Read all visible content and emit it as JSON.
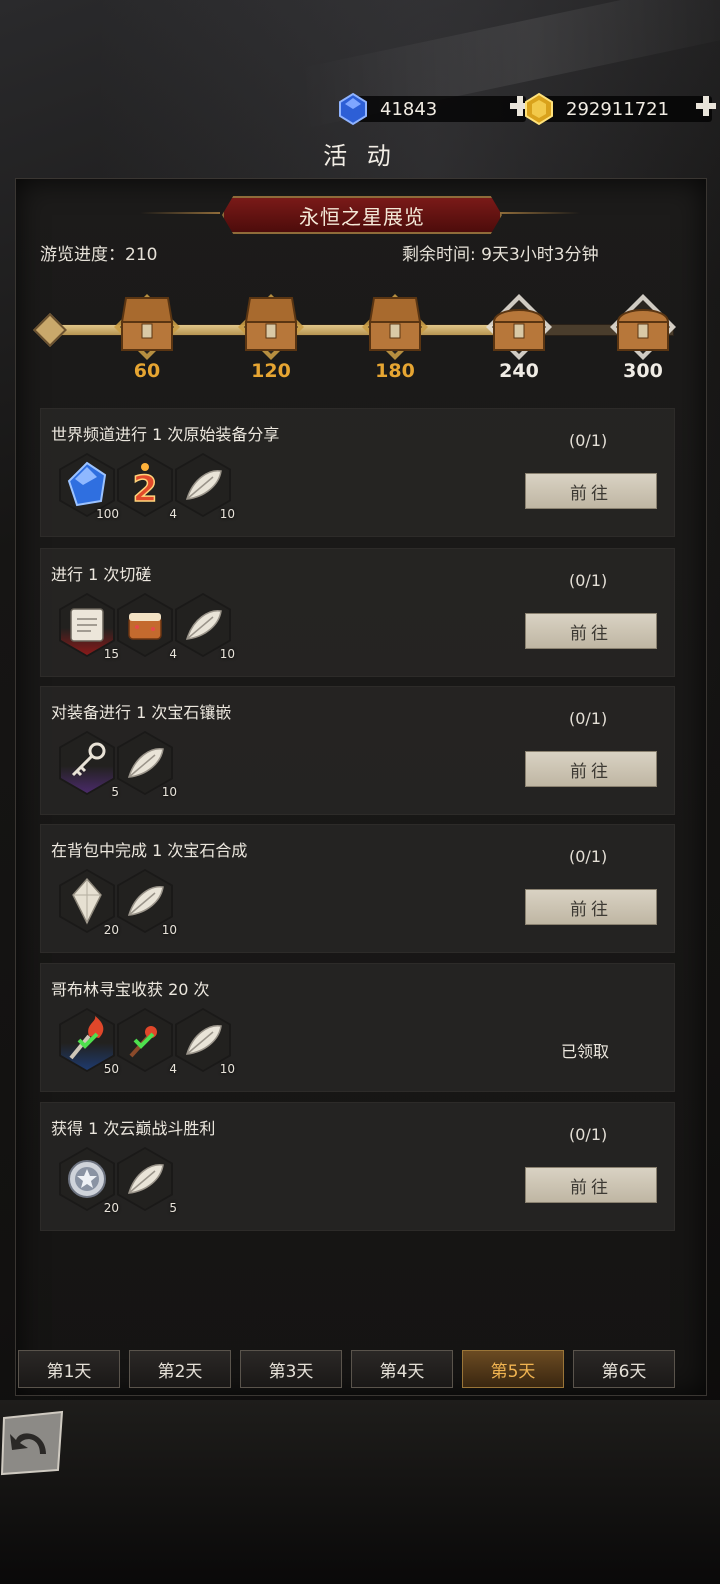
{
  "currency": {
    "gems": "41843",
    "gold": "292911721",
    "gems_icon": "blue-gem-icon",
    "gold_icon": "gold-coin-icon"
  },
  "page_title": "活 动",
  "event": {
    "name": "永恒之星展览",
    "progress_label": "游览进度：",
    "progress_value": "210",
    "time_label": "剩余时间:",
    "time_value": "9天3小时3分钟",
    "progress_fraction": 0.72
  },
  "milestones": [
    {
      "label": "60",
      "opened": true
    },
    {
      "label": "120",
      "opened": true
    },
    {
      "label": "180",
      "opened": true
    },
    {
      "label": "240",
      "opened": false
    },
    {
      "label": "300",
      "opened": false
    }
  ],
  "tasks": [
    {
      "title": "世界频道进行 1 次原始装备分享",
      "count": "(0/1)",
      "status": "go",
      "rewards": [
        {
          "icon": "blue-crystal-icon",
          "qty": "100"
        },
        {
          "icon": "number-two-icon",
          "qty": "4"
        },
        {
          "icon": "feather-icon",
          "qty": "10"
        }
      ]
    },
    {
      "title": "进行 1 次切磋",
      "count": "(0/1)",
      "status": "go",
      "rewards": [
        {
          "icon": "scroll-icon",
          "qty": "15"
        },
        {
          "icon": "cake-icon",
          "qty": "4"
        },
        {
          "icon": "feather-icon",
          "qty": "10"
        }
      ]
    },
    {
      "title": "对装备进行 1 次宝石镶嵌",
      "count": "(0/1)",
      "status": "go",
      "rewards": [
        {
          "icon": "key-icon",
          "qty": "5"
        },
        {
          "icon": "feather-icon",
          "qty": "10"
        }
      ]
    },
    {
      "title": "在背包中完成 1 次宝石合成",
      "count": "(0/1)",
      "status": "go",
      "rewards": [
        {
          "icon": "white-crystal-icon",
          "qty": "20"
        },
        {
          "icon": "feather-icon",
          "qty": "10"
        }
      ]
    },
    {
      "title": "哥布林寻宝收获 20 次",
      "count": "",
      "status": "claimed",
      "rewards": [
        {
          "icon": "torch-icon",
          "qty": "50"
        },
        {
          "icon": "firework-icon",
          "qty": "4"
        },
        {
          "icon": "feather-icon",
          "qty": "10"
        }
      ]
    },
    {
      "title": "获得 1 次云巅战斗胜利",
      "count": "(0/1)",
      "status": "go",
      "rewards": [
        {
          "icon": "star-medal-icon",
          "qty": "20"
        },
        {
          "icon": "feather-icon",
          "qty": "5"
        }
      ]
    }
  ],
  "go_label": "前往",
  "claimed_label": "已领取",
  "day_tabs": [
    "第1天",
    "第2天",
    "第3天",
    "第4天",
    "第5天",
    "第6天"
  ],
  "active_day_index": 4,
  "colors": {
    "banner_red": "#7a1a18",
    "gold_text": "#e6a532",
    "active_tab": "#f1b451"
  }
}
